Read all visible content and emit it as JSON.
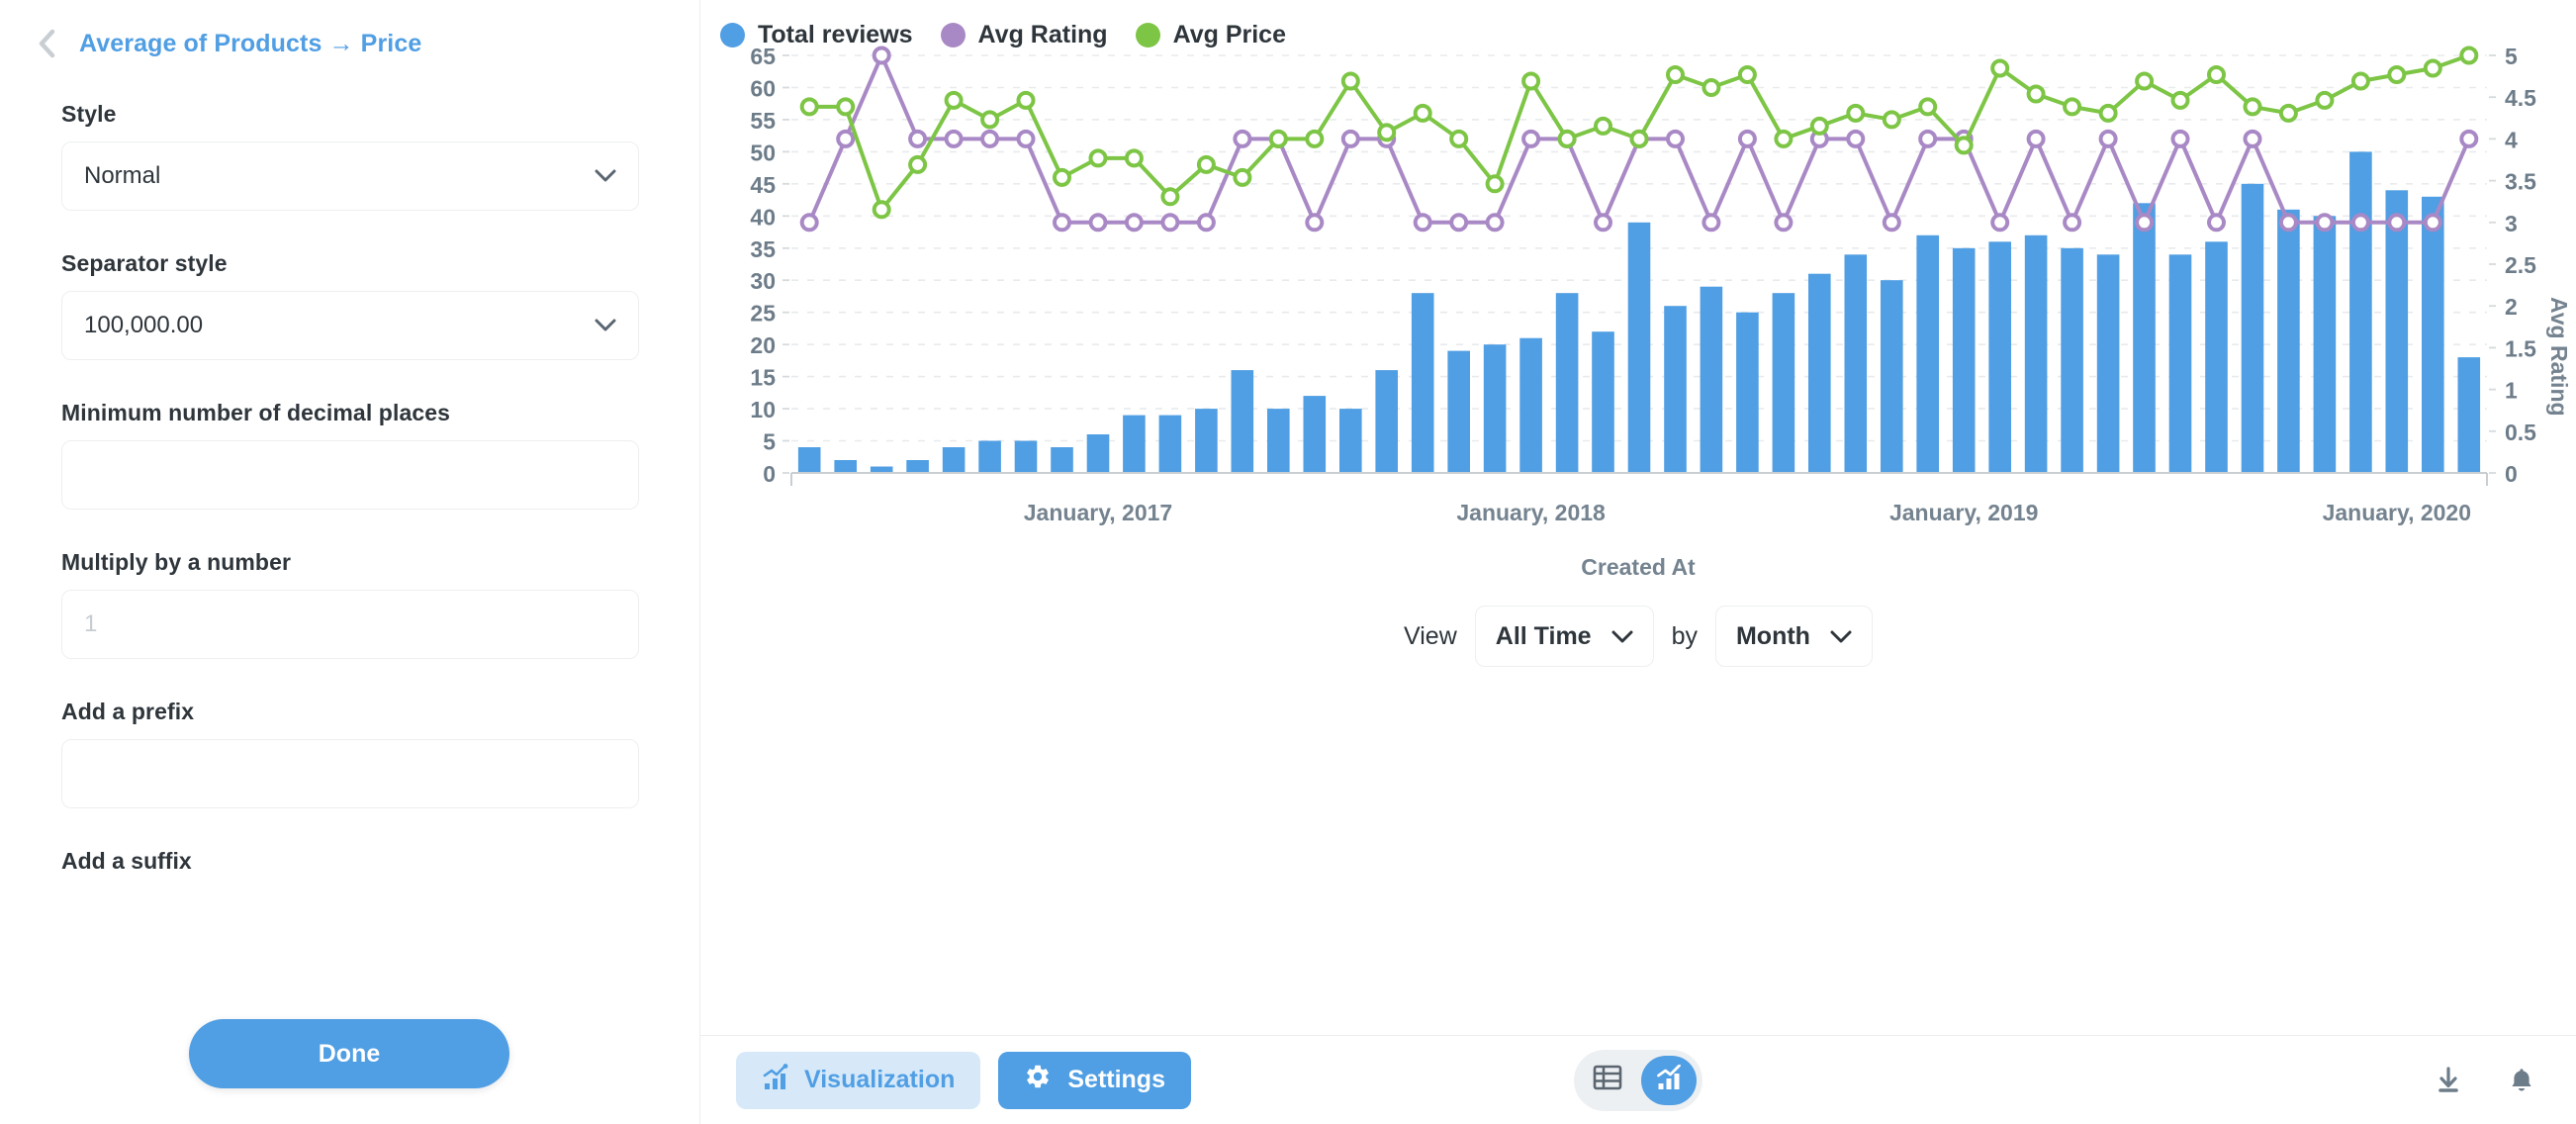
{
  "sidebar": {
    "back_icon": "chevron-left-icon",
    "title": "Average of Products → Price",
    "fields": [
      {
        "label": "Style",
        "type": "select",
        "value": "Normal"
      },
      {
        "label": "Separator style",
        "type": "select",
        "value": "100,000.00"
      },
      {
        "label": "Minimum number of decimal places",
        "type": "input",
        "value": "",
        "placeholder": ""
      },
      {
        "label": "Multiply by a number",
        "type": "input",
        "value": "",
        "placeholder": "1"
      },
      {
        "label": "Add a prefix",
        "type": "input",
        "value": "",
        "placeholder": ""
      }
    ],
    "cut_off_label": "Add a suffix",
    "done_label": "Done"
  },
  "chart_data": {
    "type": "bar",
    "title": "",
    "xlabel": "Created At",
    "ylabel": "",
    "y2label": "Avg Rating",
    "ylim": [
      0,
      65
    ],
    "y2lim": [
      0,
      5
    ],
    "yticks": [
      0,
      5,
      10,
      15,
      20,
      25,
      30,
      35,
      40,
      45,
      50,
      55,
      60,
      65
    ],
    "y2ticks": [
      0,
      0.5,
      1,
      1.5,
      2,
      2.5,
      3,
      3.5,
      4,
      4.5,
      5
    ],
    "grid": true,
    "legend_position": "top-left",
    "xtick_labels": [
      "January, 2017",
      "January, 2018",
      "January, 2019",
      "January, 2020"
    ],
    "xtick_indices": [
      8,
      20,
      32,
      44
    ],
    "legend": [
      {
        "name": "Total reviews",
        "color": "#509ee3",
        "type": "bar",
        "axis": "left"
      },
      {
        "name": "Avg Rating",
        "color": "#a989c5",
        "type": "line",
        "axis": "right"
      },
      {
        "name": "Avg Price",
        "color": "#7dc545",
        "type": "line",
        "axis": "left"
      }
    ],
    "series": [
      {
        "name": "Total reviews",
        "color": "#509ee3",
        "type": "bar",
        "axis": "left",
        "values": [
          4,
          2,
          1,
          2,
          4,
          5,
          5,
          4,
          6,
          9,
          9,
          10,
          16,
          10,
          12,
          10,
          16,
          28,
          19,
          20,
          21,
          28,
          22,
          39,
          26,
          29,
          25,
          28,
          31,
          34,
          30,
          37,
          35,
          36,
          37,
          35,
          34,
          42,
          34,
          36,
          45,
          41,
          40,
          50,
          44,
          43,
          18
        ]
      },
      {
        "name": "Avg Rating",
        "color": "#a989c5",
        "type": "line",
        "axis": "right",
        "values": [
          3,
          4,
          5,
          4,
          4,
          4,
          4,
          3,
          3,
          3,
          3,
          3,
          4,
          4,
          3,
          4,
          4,
          3,
          3,
          3,
          4,
          4,
          3,
          4,
          4,
          3,
          4,
          3,
          4,
          4,
          3,
          4,
          4,
          3,
          4,
          3,
          4,
          3,
          4,
          3,
          4,
          3,
          3,
          3,
          3,
          3,
          4
        ]
      },
      {
        "name": "Avg Price",
        "color": "#7dc545",
        "type": "line",
        "axis": "left",
        "values": [
          57,
          57,
          41,
          48,
          58,
          55,
          58,
          46,
          49,
          49,
          43,
          48,
          46,
          52,
          52,
          61,
          53,
          56,
          52,
          45,
          61,
          52,
          54,
          52,
          62,
          60,
          62,
          52,
          54,
          56,
          55,
          57,
          51,
          63,
          59,
          57,
          56,
          61,
          58,
          62,
          57,
          56,
          58,
          61,
          62,
          63,
          65
        ]
      }
    ]
  },
  "view_controls": {
    "view_label": "View",
    "range_value": "All Time",
    "by_label": "by",
    "unit_value": "Month",
    "chevron_icon": "chevron-down-icon"
  },
  "footer": {
    "visualization_label": "Visualization",
    "visualization_icon": "bar-chart-icon",
    "settings_label": "Settings",
    "settings_icon": "gear-icon",
    "table_toggle_icon": "table-icon",
    "chart_toggle_icon": "chart-icon",
    "download_icon": "download-icon",
    "alert_icon": "bell-icon"
  },
  "colors": {
    "accent": "#509ee3",
    "bar": "#509ee3",
    "rating": "#a989c5",
    "price": "#7dc545",
    "text": "#2e353b",
    "muted": "#74838f",
    "border": "#edeff0"
  }
}
